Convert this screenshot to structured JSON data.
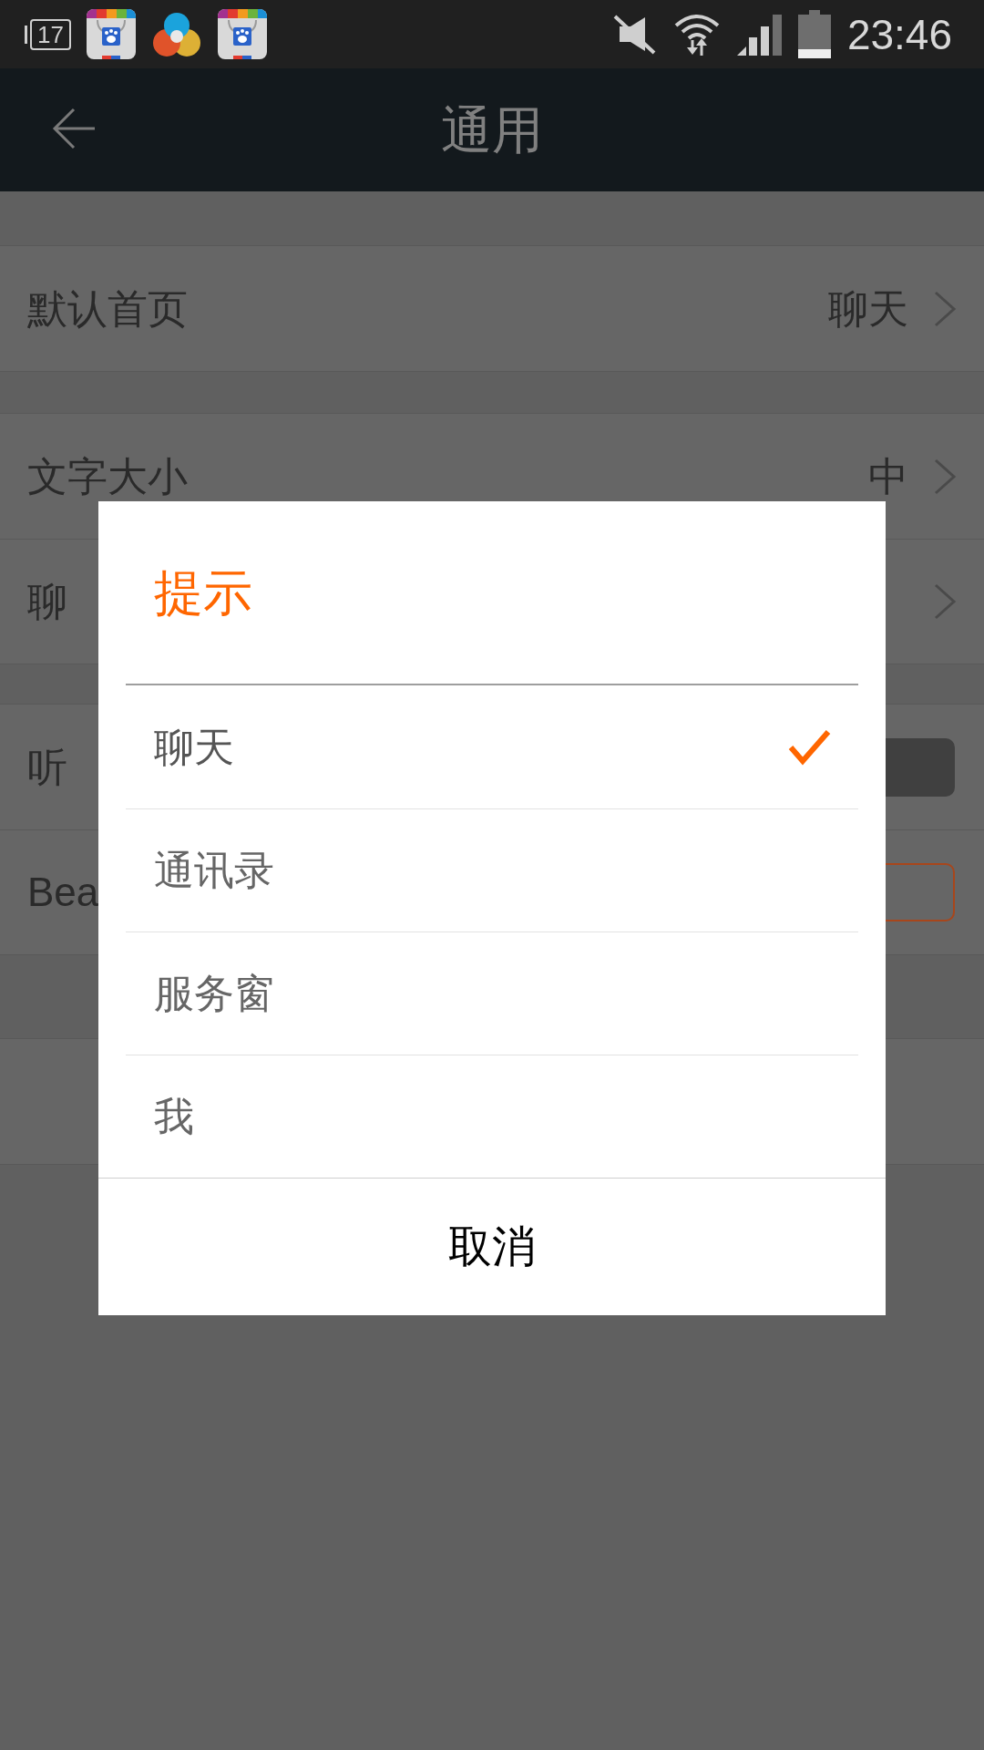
{
  "status_bar": {
    "notification_number": "17",
    "time": "23:46"
  },
  "header": {
    "title": "通用"
  },
  "settings_groups": [
    {
      "rows": [
        {
          "kind": "nav",
          "label": "默认首页",
          "value": "聊天"
        }
      ]
    },
    {
      "rows": [
        {
          "kind": "nav",
          "label": "文字大小",
          "value": "中"
        },
        {
          "kind": "nav",
          "label": "聊"
        }
      ]
    },
    {
      "rows": [
        {
          "kind": "switch",
          "label": "听",
          "on": false
        },
        {
          "kind": "switch",
          "label": "Bea",
          "on": true
        }
      ]
    },
    {
      "rows": [
        {
          "kind": "blank"
        }
      ]
    }
  ],
  "dialog": {
    "title": "提示",
    "options": [
      {
        "label": "聊天",
        "selected": true
      },
      {
        "label": "通讯录",
        "selected": false
      },
      {
        "label": "服务窗",
        "selected": false
      },
      {
        "label": "我",
        "selected": false
      }
    ],
    "cancel_button": "取消"
  }
}
